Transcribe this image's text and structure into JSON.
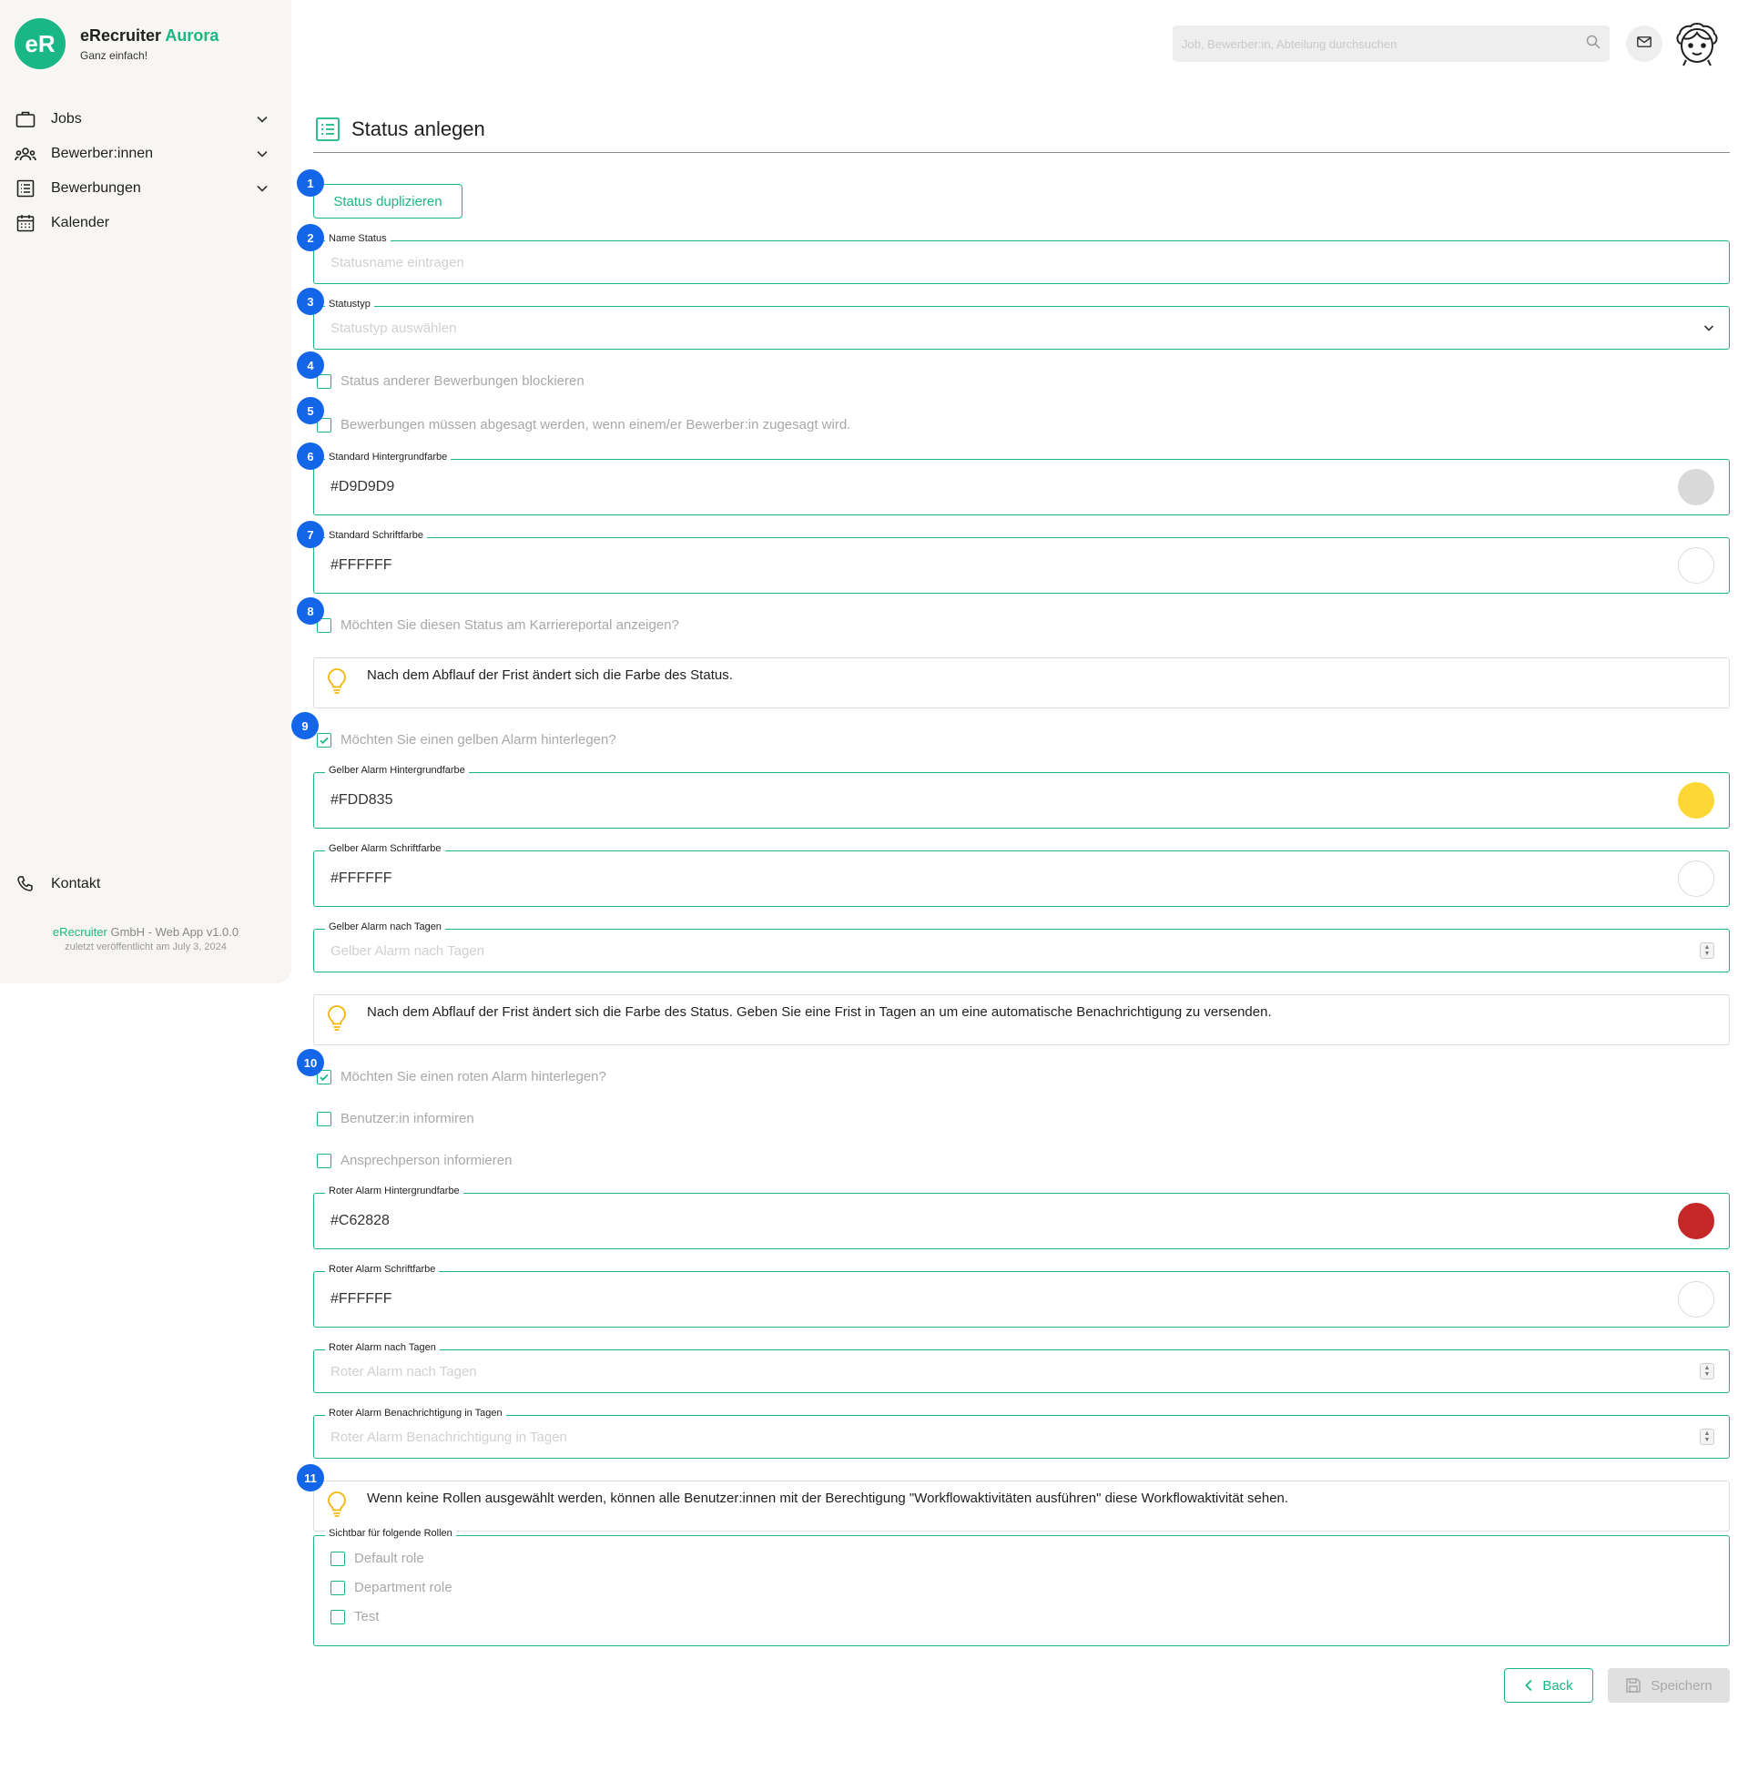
{
  "brand": {
    "logo_text": "eR",
    "name": "eRecruiter",
    "name_accent": "Aurora",
    "tagline": "Ganz einfach!"
  },
  "sidebar": {
    "items": [
      {
        "label": "Jobs",
        "icon": "briefcase-icon",
        "expandable": true
      },
      {
        "label": "Bewerber:innen",
        "icon": "people-icon",
        "expandable": true
      },
      {
        "label": "Bewerbungen",
        "icon": "list-icon",
        "expandable": true
      },
      {
        "label": "Kalender",
        "icon": "calendar-icon",
        "expandable": false
      }
    ],
    "contact": "Kontakt",
    "footer_company_accent": "eRecruiter",
    "footer_company_rest": "GmbH - Web App v1.0.0",
    "footer_release": "zuletzt veröffentlicht am July 3, 2024"
  },
  "topbar": {
    "search_placeholder": "Job, Bewerber:in, Abteilung durchsuchen"
  },
  "page": {
    "title": "Status anlegen"
  },
  "badges": [
    "1",
    "2",
    "3",
    "4",
    "5",
    "6",
    "7",
    "8",
    "9",
    "10",
    "11"
  ],
  "form": {
    "duplicate_button": "Status duplizieren",
    "name_status": {
      "label": "Name Status",
      "placeholder": "Statusname eintragen"
    },
    "statustyp": {
      "label": "Statustyp",
      "placeholder": "Statustyp auswählen"
    },
    "block_other": {
      "label": "Status anderer Bewerbungen blockieren",
      "checked": false
    },
    "must_cancel": {
      "label": "Bewerbungen müssen abgesagt werden, wenn einem/er Bewerber:in zugesagt wird.",
      "checked": false
    },
    "std_bg": {
      "label": "Standard Hintergrundfarbe",
      "value": "#D9D9D9",
      "swatch": "#D9D9D9"
    },
    "std_font": {
      "label": "Standard Schriftfarbe",
      "value": "#FFFFFF",
      "swatch": "#FFFFFF"
    },
    "portal": {
      "label": "Möchten Sie diesen Status am Karriereportal anzeigen?",
      "checked": false
    },
    "info1": "Nach dem Abflauf der Frist ändert sich die Farbe des Status.",
    "yellow_alarm": {
      "label": "Möchten Sie einen gelben Alarm hinterlegen?",
      "checked": true
    },
    "yellow_bg": {
      "label": "Gelber Alarm Hintergrundfarbe",
      "value": "#FDD835",
      "swatch": "#FDD835"
    },
    "yellow_font": {
      "label": "Gelber Alarm Schriftfarbe",
      "value": "#FFFFFF",
      "swatch": "#FFFFFF"
    },
    "yellow_days": {
      "label": "Gelber Alarm nach Tagen",
      "placeholder": "Gelber Alarm nach Tagen"
    },
    "info2": "Nach dem Abflauf der Frist ändert sich die Farbe des Status. Geben Sie eine Frist in Tagen an um eine automatische Benachrichtigung zu versenden.",
    "red_alarm": {
      "label": "Möchten Sie einen roten Alarm hinterlegen?",
      "checked": true
    },
    "inform_user": {
      "label": "Benutzer:in informiren",
      "checked": false
    },
    "inform_contact": {
      "label": "Ansprechperson informieren",
      "checked": false
    },
    "red_bg": {
      "label": "Roter Alarm Hintergrundfarbe",
      "value": "#C62828",
      "swatch": "#C62828"
    },
    "red_font": {
      "label": "Roter Alarm Schriftfarbe",
      "value": "#FFFFFF",
      "swatch": "#FFFFFF"
    },
    "red_days": {
      "label": "Roter Alarm nach Tagen",
      "placeholder": "Roter Alarm nach Tagen"
    },
    "red_notify": {
      "label": "Roter Alarm Benachrichtigung in Tagen",
      "placeholder": "Roter Alarm Benachrichtigung in Tagen"
    },
    "info3": "Wenn keine Rollen ausgewählt werden, können alle Benutzer:innen mit der Berechtigung \"Workflowaktivitäten ausführen\" diese Workflowaktivität sehen.",
    "roles": {
      "label": "Sichtbar für folgende Rollen",
      "options": [
        "Default role",
        "Department role",
        "Test"
      ]
    }
  },
  "actions": {
    "back": "Back",
    "save": "Speichern"
  },
  "colors": {
    "accent": "#19B785",
    "badge": "#1366E8",
    "bulb": "#F2B705"
  }
}
